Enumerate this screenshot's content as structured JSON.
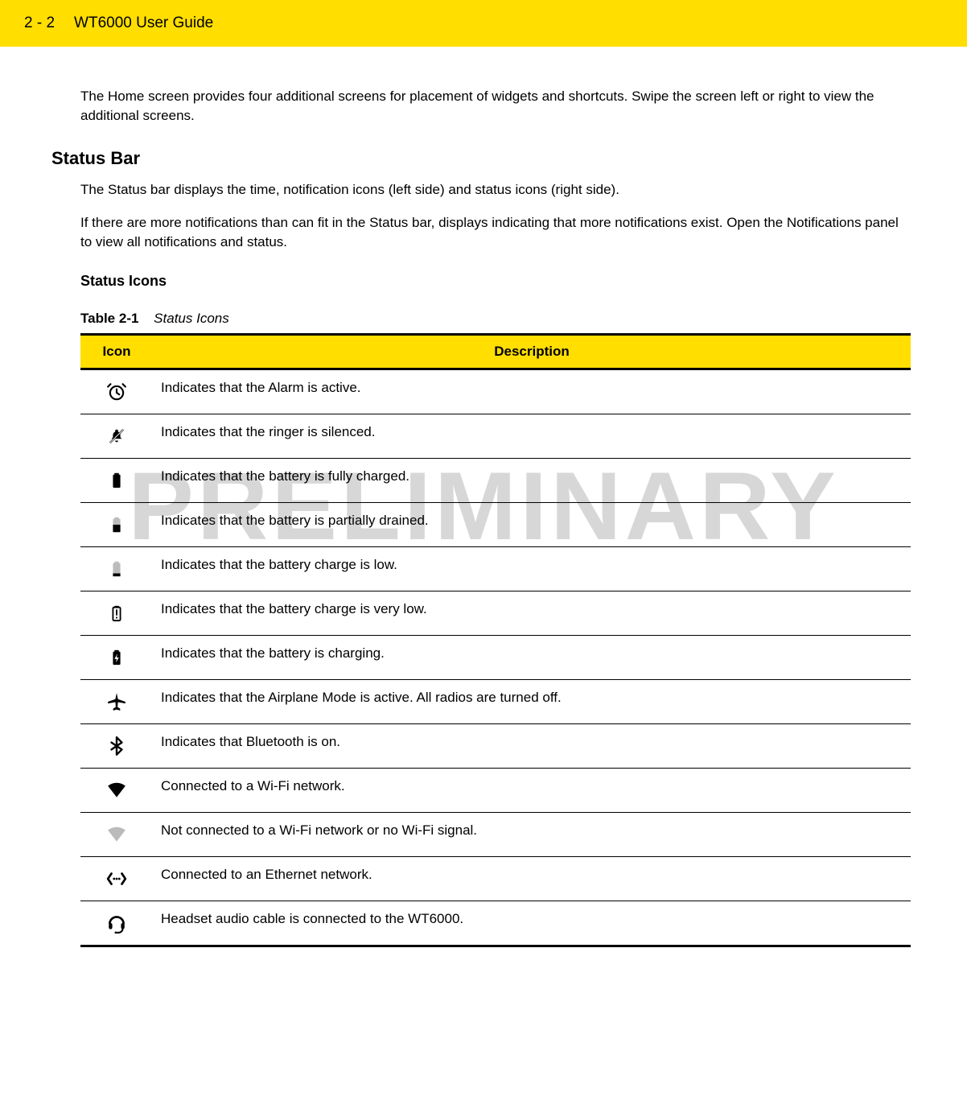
{
  "header": {
    "page_number": "2 - 2",
    "title": "WT6000 User Guide"
  },
  "watermark": "PRELIMINARY",
  "intro_paragraph": "The Home screen provides four additional screens for placement of widgets and shortcuts. Swipe the screen left or right to view the additional screens.",
  "section_status_bar": {
    "heading": "Status Bar",
    "paragraph1": "The Status bar displays the time, notification icons (left side) and status icons (right side).",
    "paragraph2": "If there are more notifications than can fit in the Status bar, displays indicating that more notifications exist. Open the Notifications panel to view all notifications and status."
  },
  "section_status_icons": {
    "heading": "Status Icons",
    "table_caption_label": "Table 2-1",
    "table_caption_text": "Status Icons",
    "columns": {
      "icon": "Icon",
      "description": "Description"
    },
    "rows": [
      {
        "icon": "alarm",
        "description": "Indicates that the Alarm is active."
      },
      {
        "icon": "ringer-silenced",
        "description": "Indicates that the ringer is silenced."
      },
      {
        "icon": "battery-full",
        "description": "Indicates that the battery is fully charged."
      },
      {
        "icon": "battery-partial",
        "description": "Indicates that the battery is partially drained."
      },
      {
        "icon": "battery-low",
        "description": "Indicates that the battery charge is low."
      },
      {
        "icon": "battery-very-low",
        "description": "Indicates that the battery charge is very low."
      },
      {
        "icon": "battery-charging",
        "description": "Indicates that the battery is charging."
      },
      {
        "icon": "airplane-mode",
        "description": "Indicates that the Airplane Mode is active. All radios are turned off."
      },
      {
        "icon": "bluetooth",
        "description": "Indicates that Bluetooth is on."
      },
      {
        "icon": "wifi-connected",
        "description": "Connected to a Wi-Fi network."
      },
      {
        "icon": "wifi-disconnected",
        "description": "Not connected to a Wi-Fi network or no Wi-Fi signal."
      },
      {
        "icon": "ethernet",
        "description": "Connected to an Ethernet network."
      },
      {
        "icon": "headset",
        "description": "Headset audio cable is connected to the WT6000."
      }
    ]
  }
}
